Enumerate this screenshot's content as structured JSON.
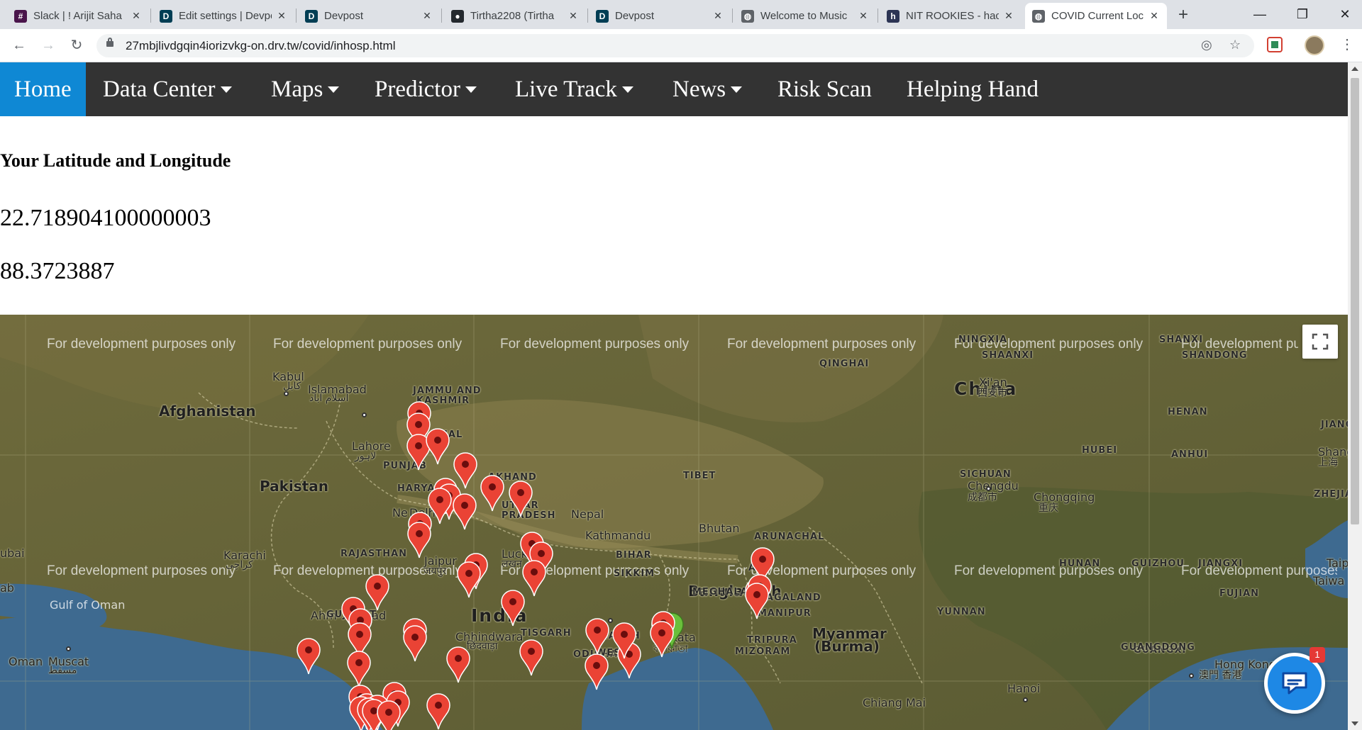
{
  "browser": {
    "tabs": [
      {
        "title": "Slack | ! Arijit Saha",
        "icon": "slack-icon",
        "color": "#4a154b",
        "glyph": "#"
      },
      {
        "title": "Edit settings | Devpost",
        "icon": "devpost-icon",
        "color": "#003e54",
        "glyph": "D"
      },
      {
        "title": "Devpost",
        "icon": "devpost-icon",
        "color": "#003e54",
        "glyph": "D"
      },
      {
        "title": "Tirtha2208 (Tirtha",
        "icon": "github-icon",
        "color": "#24292e",
        "glyph": "●"
      },
      {
        "title": "Devpost",
        "icon": "devpost-icon",
        "color": "#003e54",
        "glyph": "D"
      },
      {
        "title": "Welcome to Music",
        "icon": "globe-icon",
        "color": "#5f6368",
        "glyph": "◍"
      },
      {
        "title": "NIT ROOKIES - hac",
        "icon": "hackerearth-icon",
        "color": "#2c3454",
        "glyph": "h"
      },
      {
        "title": "COVID Current Loc",
        "icon": "globe-icon",
        "color": "#5f6368",
        "glyph": "◍",
        "active": true
      }
    ],
    "new_tab_label": "+",
    "url": "27mbjlivdgqin4iorizvkg-on.drv.tw/covid/inhosp.html"
  },
  "navbar": {
    "items": [
      {
        "label": "Home",
        "dropdown": false,
        "active": true
      },
      {
        "label": "Data Center",
        "dropdown": true
      },
      {
        "label": "Maps",
        "dropdown": true
      },
      {
        "label": "Predictor",
        "dropdown": true
      },
      {
        "label": "Live Track",
        "dropdown": true
      },
      {
        "label": "News",
        "dropdown": true
      },
      {
        "label": "Risk Scan",
        "dropdown": false
      },
      {
        "label": "Helping Hand",
        "dropdown": false
      }
    ],
    "active_color": "#0f88d4",
    "bg_color": "#333333"
  },
  "location": {
    "heading": "Your Latitude and Longitude",
    "latitude": "22.718904100000003",
    "longitude": "88.3723887"
  },
  "map": {
    "dev_watermark": "For development purposes only",
    "marker_color": "#ea4335",
    "user_marker_color": "#6abf3b",
    "labels": [
      {
        "text": "Afghanistan",
        "kind": "country"
      },
      {
        "text": "Pakistan",
        "kind": "country"
      },
      {
        "text": "India",
        "kind": "big"
      },
      {
        "text": "China",
        "kind": "big"
      },
      {
        "text": "Nepal",
        "kind": "city"
      },
      {
        "text": "Bhutan",
        "kind": "city"
      },
      {
        "text": "Bangladesh",
        "kind": "country"
      },
      {
        "text": "Myanmar",
        "kind": "country"
      },
      {
        "text": "(Burma)",
        "kind": "country"
      },
      {
        "text": "Oman",
        "kind": "city"
      },
      {
        "text": "Kabul",
        "kind": "city"
      },
      {
        "text": "کابل",
        "kind": "native"
      },
      {
        "text": "Islamabad",
        "kind": "city"
      },
      {
        "text": "اسلام آباد",
        "kind": "native"
      },
      {
        "text": "Lahore",
        "kind": "city"
      },
      {
        "text": "لاہور",
        "kind": "native"
      },
      {
        "text": "Karachi",
        "kind": "city"
      },
      {
        "text": "کراچی",
        "kind": "native"
      },
      {
        "text": "Muscat",
        "kind": "city"
      },
      {
        "text": "مسقط",
        "kind": "native"
      },
      {
        "text": "Gulf of Oman",
        "kind": "light"
      },
      {
        "text": "Jaipur",
        "kind": "city"
      },
      {
        "text": "जयपुर",
        "kind": "native"
      },
      {
        "text": "Ne",
        "kind": "city"
      },
      {
        "text": "Delhi",
        "kind": "city"
      },
      {
        "text": "Luck",
        "kind": "city"
      },
      {
        "text": "लखन",
        "kind": "native"
      },
      {
        "text": "Kathmandu",
        "kind": "city"
      },
      {
        "text": "Ahm",
        "kind": "city"
      },
      {
        "text": "bad",
        "kind": "city"
      },
      {
        "text": "Chhindwara",
        "kind": "city"
      },
      {
        "text": "छिंदवाड़ा",
        "kind": "native"
      },
      {
        "text": "Kolkata",
        "kind": "city"
      },
      {
        "text": "কলকাতা",
        "kind": "native"
      },
      {
        "text": "Hanoi",
        "kind": "city"
      },
      {
        "text": "Hong Kong",
        "kind": "city"
      },
      {
        "text": "澳門 香港",
        "kind": "native"
      },
      {
        "text": "Chiang Mai",
        "kind": "city"
      },
      {
        "text": "Chengdu",
        "kind": "city"
      },
      {
        "text": "成都市",
        "kind": "native"
      },
      {
        "text": "Chongqing",
        "kind": "city"
      },
      {
        "text": "重庆",
        "kind": "native"
      },
      {
        "text": "Xi'an",
        "kind": "city"
      },
      {
        "text": "西安市",
        "kind": "native"
      },
      {
        "text": "Shang",
        "kind": "city"
      },
      {
        "text": "上海",
        "kind": "native"
      },
      {
        "text": "Taiwa",
        "kind": "city"
      },
      {
        "text": "Taip",
        "kind": "city"
      },
      {
        "text": "ubai",
        "kind": "city"
      },
      {
        "text": "ab",
        "kind": "city"
      },
      {
        "text": "JAMMU AND",
        "kind": "region"
      },
      {
        "text": "KASHMIR",
        "kind": "region"
      },
      {
        "text": "HAL",
        "kind": "region"
      },
      {
        "text": "PUNJAB",
        "kind": "region"
      },
      {
        "text": "HARYA",
        "kind": "region"
      },
      {
        "text": "AKHAND",
        "kind": "region"
      },
      {
        "text": "UTTAR",
        "kind": "region"
      },
      {
        "text": "PRADESH",
        "kind": "region"
      },
      {
        "text": "RAJASTHAN",
        "kind": "region"
      },
      {
        "text": "GUJARAT",
        "kind": "region"
      },
      {
        "text": "TISGARH",
        "kind": "region"
      },
      {
        "text": "ODISHA",
        "kind": "region"
      },
      {
        "text": "JHARKH",
        "kind": "region"
      },
      {
        "text": "WEST B",
        "kind": "region"
      },
      {
        "text": "BIHAR",
        "kind": "region"
      },
      {
        "text": "SIKKIM",
        "kind": "region"
      },
      {
        "text": "MEGHALA",
        "kind": "region"
      },
      {
        "text": "AM",
        "kind": "region"
      },
      {
        "text": "NAGALAND",
        "kind": "region"
      },
      {
        "text": "MANIPUR",
        "kind": "region"
      },
      {
        "text": "TRIPURA",
        "kind": "region"
      },
      {
        "text": "MIZORAM",
        "kind": "region"
      },
      {
        "text": "ARUNACHAL",
        "kind": "region"
      },
      {
        "text": "TIBET",
        "kind": "region"
      },
      {
        "text": "QINGHAI",
        "kind": "region"
      },
      {
        "text": "NINGXIA",
        "kind": "region"
      },
      {
        "text": "SHANXI",
        "kind": "region"
      },
      {
        "text": "SHAANXI",
        "kind": "region"
      },
      {
        "text": "SHANDONG",
        "kind": "region"
      },
      {
        "text": "HENAN",
        "kind": "region"
      },
      {
        "text": "JIANGSU",
        "kind": "region"
      },
      {
        "text": "HUBEI",
        "kind": "region"
      },
      {
        "text": "ANHUI",
        "kind": "region"
      },
      {
        "text": "SICHUAN",
        "kind": "region"
      },
      {
        "text": "ZHEJIANG",
        "kind": "region"
      },
      {
        "text": "HUNAN",
        "kind": "region"
      },
      {
        "text": "GUIZHOU",
        "kind": "region"
      },
      {
        "text": "JIANGXI",
        "kind": "region"
      },
      {
        "text": "FUJIAN",
        "kind": "region"
      },
      {
        "text": "YUNNAN",
        "kind": "region"
      },
      {
        "text": "GUANGXI",
        "kind": "region"
      },
      {
        "text": "GUANGDONG",
        "kind": "region"
      }
    ],
    "markers_count": 51
  },
  "chat": {
    "badge_count": "1",
    "icon": "chat-icon"
  }
}
